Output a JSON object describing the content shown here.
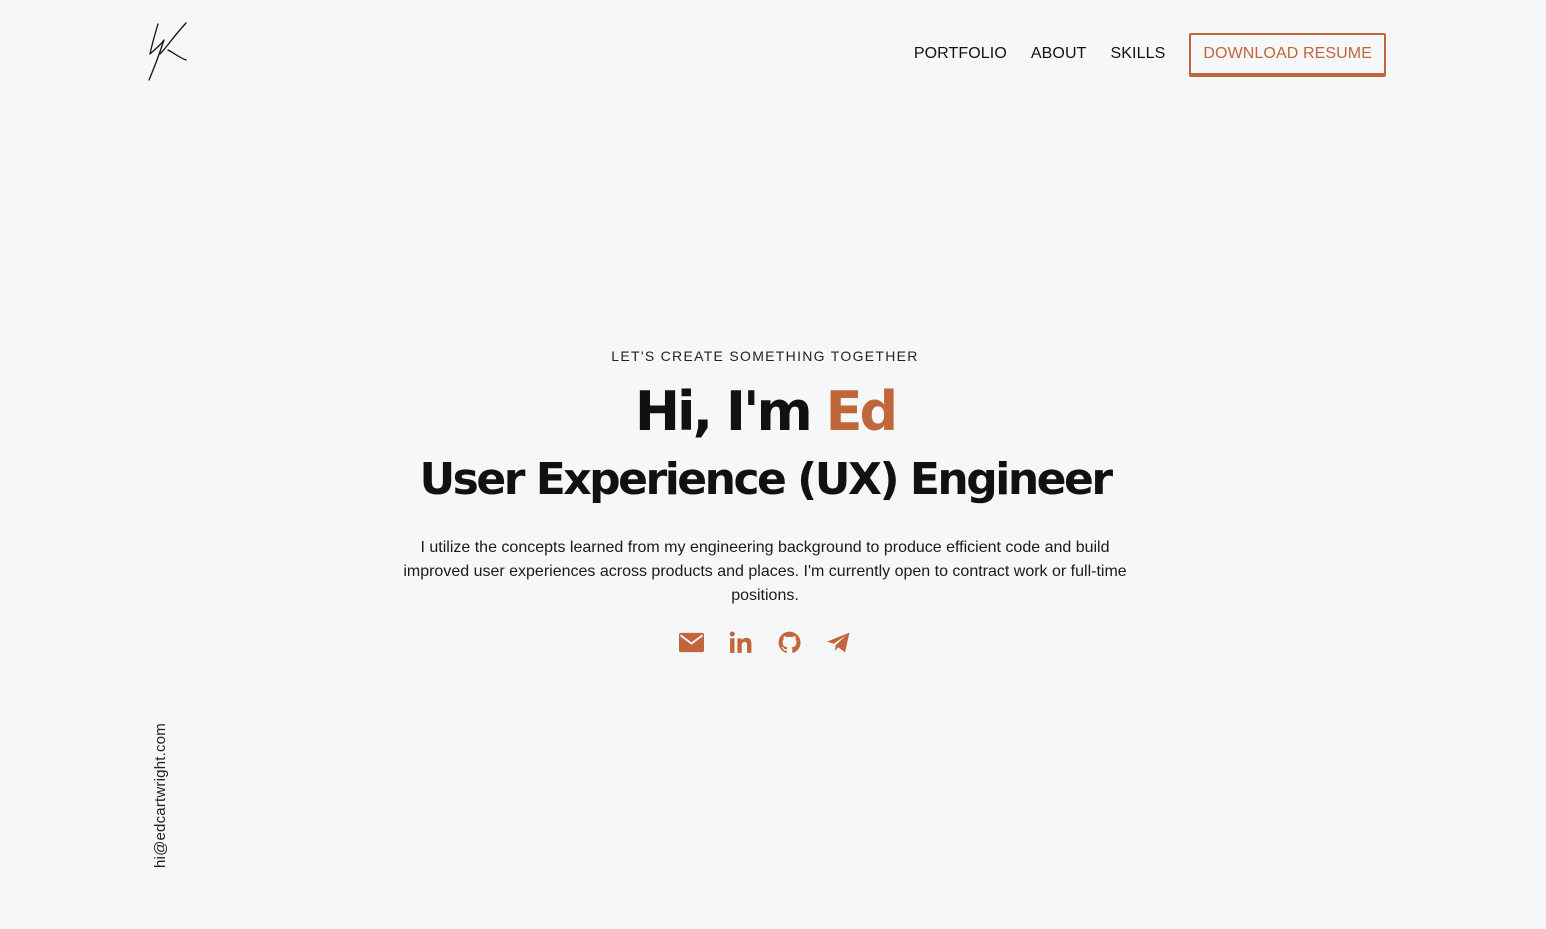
{
  "nav": {
    "links": [
      "PORTFOLIO",
      "ABOUT",
      "SKILLS"
    ],
    "resume_label": "DOWNLOAD RESUME"
  },
  "hero": {
    "eyebrow": "LET'S CREATE SOMETHING TOGETHER",
    "greeting": "Hi, I'm ",
    "name": "Ed",
    "title": "User Experience (UX) Engineer",
    "description": "I utilize the concepts learned from my engineering background to produce efficient code and build improved user experiences across products and places. I'm currently open to contract work or full-time positions."
  },
  "socials": [
    {
      "icon": "envelope-icon"
    },
    {
      "icon": "linkedin-icon"
    },
    {
      "icon": "github-icon"
    },
    {
      "icon": "telegram-icon"
    }
  ],
  "contact": {
    "email": "hi@edcartwright.com"
  },
  "colors": {
    "accent": "#c0663a",
    "background": "#f6f7f9",
    "text": "#111111"
  }
}
